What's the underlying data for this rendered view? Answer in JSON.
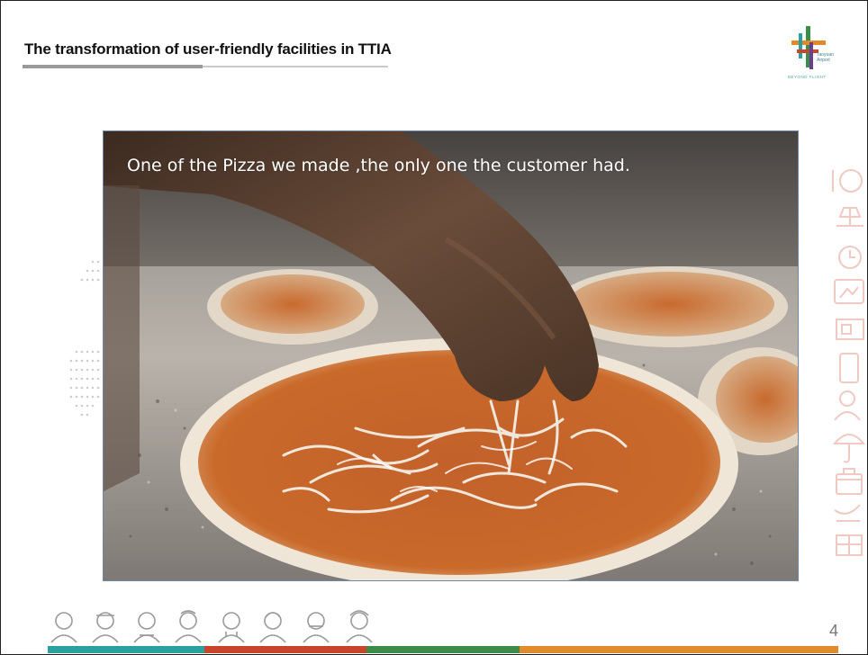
{
  "slide": {
    "title": "The transformation of user-friendly facilities in TTIA",
    "caption": "One of the Pizza we made ,the only one the customer had.",
    "page_number": "4"
  },
  "logo": {
    "line1": "Taoyuan",
    "line2": "Airport",
    "tagline": "BEYOND FLIGHT"
  },
  "colors": {
    "footer_teal": "#2aa1a0",
    "footer_red": "#c8452b",
    "footer_green": "#3c8d48",
    "footer_orange": "#e08a2c",
    "photo_border": "#6f87a8"
  }
}
